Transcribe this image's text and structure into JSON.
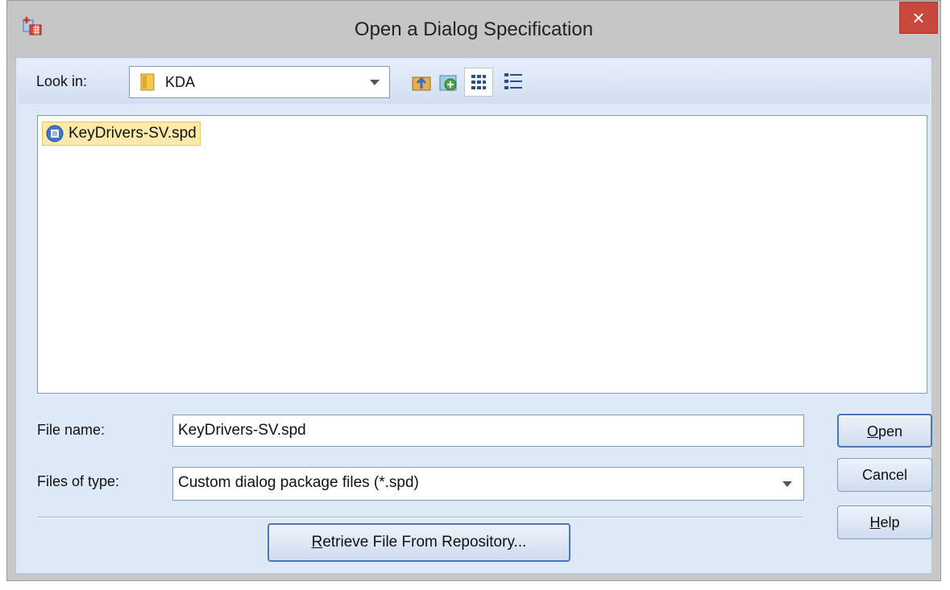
{
  "window": {
    "title": "Open a Dialog Specification",
    "close_label": "×"
  },
  "lookin": {
    "label": "Look in:",
    "value": "KDA"
  },
  "toolbar": {
    "icons": [
      "up-folder-icon",
      "new-folder-icon",
      "list-view-icon",
      "details-view-icon"
    ]
  },
  "filelist": {
    "items": [
      {
        "name": "KeyDrivers-SV.spd",
        "icon": "spd-file-icon",
        "selected": true
      }
    ]
  },
  "filename": {
    "label": "File name:",
    "value": "KeyDrivers-SV.spd"
  },
  "filetype": {
    "label": "Files of type:",
    "value": "Custom dialog package files (*.spd)"
  },
  "buttons": {
    "open_first": "O",
    "open_rest": "pen",
    "cancel": "Cancel",
    "help_first": "H",
    "help_rest": "elp",
    "retrieve_first": "R",
    "retrieve_rest": "etrieve File From Repository..."
  },
  "colors": {
    "accent": "#4a77b6",
    "selection": "#fde9a8",
    "close": "#c9483d"
  }
}
